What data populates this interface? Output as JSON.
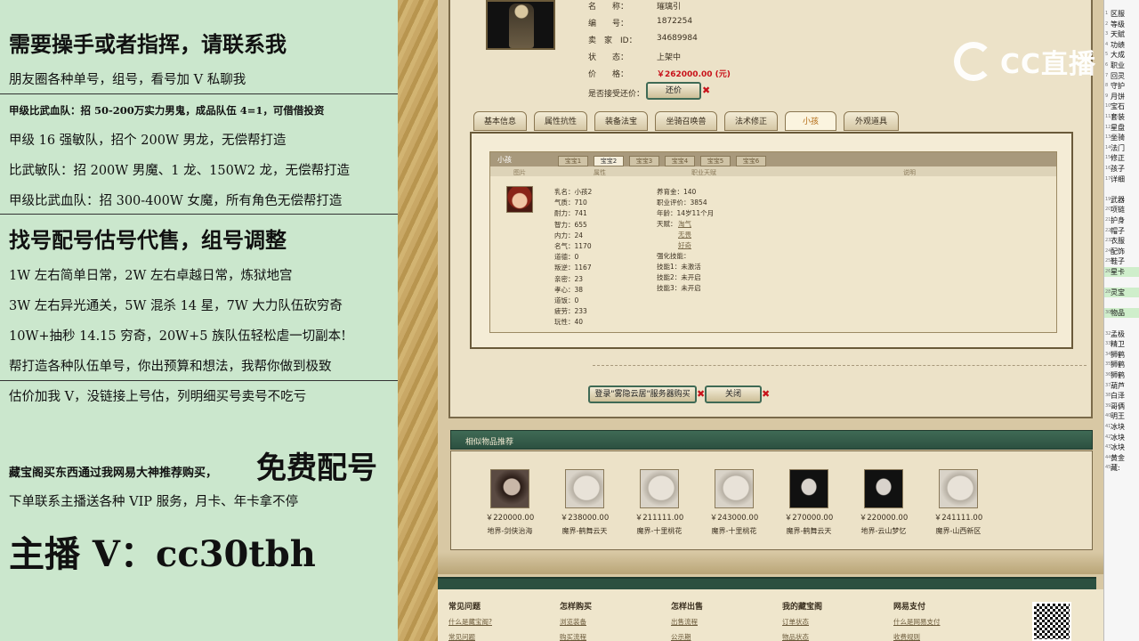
{
  "left_panel": {
    "lines": [
      "需要操手或者指挥，请联系我",
      "朋友圈各种单号，组号，看号加 V 私聊我",
      "甲级比武血队：招 50-200万实力男鬼，成品队伍 4=1，可借借投资",
      "甲级 16 强敏队，招个 200W 男龙，无偿帮打造",
      "比武敏队：招 200W 男魔、1 龙、150W2 龙，无偿帮打造",
      "甲级比武血队：招 300-400W 女魔，所有角色无偿帮打造",
      "找号配号估号代售，组号调整",
      "1W 左右简单日常，2W 左右卓越日常，炼狱地宫",
      "3W 左右异光通关，5W 混杀 14 星，7W 大力队伍砍穷奇",
      "10W+抽秒 14.15 穷奇，20W+5 族队伍轻松虐一切副本!",
      "帮打造各种队伍单号，你出预算和想法，我帮你做到极致",
      "估价加我 V，没链接上号估，列明细买号卖号不吃亏",
      "藏宝阁买东西通过我网易大神推荐购买，",
      "免费配号",
      "下单联系主播送各种 VIP 服务，月卡、年卡拿不停",
      "主播 V：cc30tbh"
    ]
  },
  "header_info": {
    "name_key": "名　　称：",
    "name_val": "璀璃引",
    "id_key": "编　　号：",
    "id_val": "1872254",
    "seller_key": "卖　家　ID：",
    "seller_val": "34689984",
    "status_key": "状　　态：",
    "status_val": "上架中",
    "price_key": "价　　格：",
    "price_val": "￥262000.00 (元)",
    "bargain_key": "是否接受还价：",
    "bargain_btn": "还价"
  },
  "tabs": [
    "基本信息",
    "属性抗性",
    "装备法宝",
    "坐骑召唤兽",
    "法术修正",
    "小孩",
    "外观道具"
  ],
  "active_tab": 5,
  "child_panel": {
    "title": "小孩",
    "pet_tabs": [
      "宝宝1",
      "宝宝2",
      "宝宝3",
      "宝宝4",
      "宝宝5",
      "宝宝6"
    ],
    "active_pet_tab": 1,
    "col_headers": [
      "图片",
      "属性",
      "职业天赋",
      "说明"
    ],
    "stats_left": [
      "乳名：小孩2",
      "气质：710",
      "耐力：741",
      "智力：655",
      "内力：24",
      "名气：1170",
      "道德：0",
      "叛逆：1167",
      "亲密：23",
      "孝心：38",
      "道饭：0",
      "疲劳：233",
      "玩性：40"
    ],
    "stats_right": [
      "养育金：140",
      "职业评价：3854",
      "年龄：14岁11个月",
      "天赋：",
      "强化技能：",
      "技能1：未激活",
      "技能2：未开启",
      "技能3：未开启"
    ],
    "talents": [
      "淘气",
      "无畏",
      "好奇"
    ]
  },
  "actions": {
    "login_btn": "登录\"雾隐云居\"服务器购买",
    "close_btn": "关闭"
  },
  "recommend": {
    "title": "相似物品推荐",
    "items": [
      {
        "price": "￥220000.00",
        "server": "地界-剑侠治海",
        "img": "brown"
      },
      {
        "price": "￥238000.00",
        "server": "魔界-鹤舞云天",
        "img": "light"
      },
      {
        "price": "￥211111.00",
        "server": "魔界-十里桃花",
        "img": "light"
      },
      {
        "price": "￥243000.00",
        "server": "魔界-十里桃花",
        "img": "light"
      },
      {
        "price": "￥270000.00",
        "server": "魔界-鹤舞云天",
        "img": "dark"
      },
      {
        "price": "￥220000.00",
        "server": "地界-云山梦忆",
        "img": "dark"
      },
      {
        "price": "￥241111.00",
        "server": "魔界-山西新区",
        "img": "light"
      }
    ]
  },
  "footer": {
    "cols": [
      {
        "head": "常见问题",
        "links": [
          "什么是藏宝阁?",
          "常见问题"
        ]
      },
      {
        "head": "怎样购买",
        "links": [
          "浏览装备",
          "购买流程"
        ]
      },
      {
        "head": "怎样出售",
        "links": [
          "出售流程",
          "公示期"
        ]
      },
      {
        "head": "我的藏宝阁",
        "links": [
          "订单状态",
          "物品状态"
        ]
      },
      {
        "head": "网易支付",
        "links": [
          "什么是网易支付",
          "收费规则"
        ]
      }
    ]
  },
  "logo_text": "CC直播",
  "right_list": [
    {
      "n": "1",
      "t": "区服"
    },
    {
      "n": "2",
      "t": "等级"
    },
    {
      "n": "3",
      "t": "天赋"
    },
    {
      "n": "4",
      "t": "功绩"
    },
    {
      "n": "5",
      "t": "大成"
    },
    {
      "n": "6",
      "t": "职业"
    },
    {
      "n": "7",
      "t": "回灵"
    },
    {
      "n": "8",
      "t": "守护"
    },
    {
      "n": "9",
      "t": "月饼"
    },
    {
      "n": "10",
      "t": "宝石"
    },
    {
      "n": "11",
      "t": "套装"
    },
    {
      "n": "12",
      "t": "星盘"
    },
    {
      "n": "13",
      "t": "坐骑"
    },
    {
      "n": "14",
      "t": "法门"
    },
    {
      "n": "15",
      "t": "修正"
    },
    {
      "n": "16",
      "t": "孩子"
    },
    {
      "n": "17",
      "t": "详细"
    },
    {
      "n": "",
      "t": ""
    },
    {
      "n": "19",
      "t": "武器"
    },
    {
      "n": "20",
      "t": "项链"
    },
    {
      "n": "21",
      "t": "护身"
    },
    {
      "n": "22",
      "t": "帽子"
    },
    {
      "n": "23",
      "t": "衣服"
    },
    {
      "n": "24",
      "t": "配饰"
    },
    {
      "n": "25",
      "t": "鞋子"
    },
    {
      "n": "26",
      "t": "星卡"
    },
    {
      "n": "",
      "t": ""
    },
    {
      "n": "28",
      "t": "灵宝"
    },
    {
      "n": "",
      "t": ""
    },
    {
      "n": "30",
      "t": "物品"
    },
    {
      "n": "",
      "t": ""
    },
    {
      "n": "32",
      "t": "孟极"
    },
    {
      "n": "33",
      "t": "精卫"
    },
    {
      "n": "34",
      "t": "狮鹤"
    },
    {
      "n": "35",
      "t": "狮鹤"
    },
    {
      "n": "36",
      "t": "狮鹤"
    },
    {
      "n": "37",
      "t": "葫芦"
    },
    {
      "n": "38",
      "t": "白泽"
    },
    {
      "n": "39",
      "t": "哥俩"
    },
    {
      "n": "40",
      "t": "明王"
    },
    {
      "n": "41",
      "t": "冰块"
    },
    {
      "n": "42",
      "t": "冰块"
    },
    {
      "n": "43",
      "t": "冰块"
    },
    {
      "n": "44",
      "t": "黄金"
    },
    {
      "n": "45",
      "t": "藏:"
    }
  ]
}
